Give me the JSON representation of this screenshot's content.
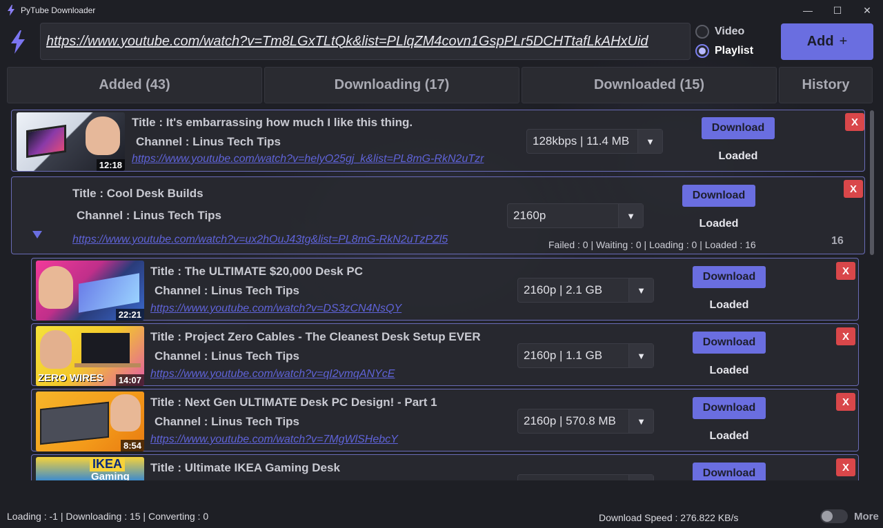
{
  "window": {
    "title": "PyTube Downloader",
    "icon": "bolt-icon",
    "minimize": "—",
    "maximize": "☐",
    "close": "✕"
  },
  "top": {
    "url_value": "https://www.youtube.com/watch?v=Tm8LGxTLtQk&list=PLlqZM4covn1GspPLr5DCHTtafLkAHxUid",
    "mode_video": "Video",
    "mode_playlist": "Playlist",
    "selected_mode": "Playlist",
    "add_label": "Add",
    "add_plus": "+"
  },
  "tabs": {
    "added": "Added (43)",
    "downloading": "Downloading (17)",
    "downloaded": "Downloaded (15)",
    "history": "History"
  },
  "items": [
    {
      "title": "Title : It's embarrassing how much I like this thing.",
      "channel": "Channel : Linus Tech Tips",
      "link": "https://www.youtube.com/watch?v=helyO25gj_k&list=PL8mG-RkN2uTzr",
      "duration": "12:18",
      "quality": "128kbps | 11.4 MB",
      "download_label": "Download",
      "status": "Loaded",
      "remove": "X"
    }
  ],
  "playlist": {
    "title": "Title : Cool Desk Builds",
    "channel": "Channel : Linus Tech Tips",
    "link": "https://www.youtube.com/watch?v=ux2hOuJ43tg&list=PL8mG-RkN2uTzPZl5",
    "quality": "2160p",
    "download_label": "Download",
    "status": "Loaded",
    "stats": "Failed : 0 |   Waiting : 0 |   Loading : 0 |   Loaded : 16",
    "count": "16",
    "remove": "X",
    "videos": [
      {
        "title": "Title : The ULTIMATE $20,000 Desk PC",
        "channel": "Channel : Linus Tech Tips",
        "link": "https://www.youtube.com/watch?v=DS3zCN4NsQY",
        "duration": "22:21",
        "quality": "2160p | 2.1 GB",
        "download_label": "Download",
        "status": "Loaded",
        "remove": "X"
      },
      {
        "title": "Title : Project Zero Cables - The Cleanest Desk Setup EVER",
        "channel": "Channel : Linus Tech Tips",
        "link": "https://www.youtube.com/watch?v=qI2vmqANYcE",
        "duration": "14:07",
        "thumb_text": "ZERO WIRES",
        "quality": "2160p | 1.1 GB",
        "download_label": "Download",
        "status": "Loaded",
        "remove": "X"
      },
      {
        "title": "Title : Next Gen ULTIMATE Desk PC Design! - Part 1",
        "channel": "Channel : Linus Tech Tips",
        "link": "https://www.youtube.com/watch?v=7MgWlSHebcY",
        "duration": "8:54",
        "quality": "2160p | 570.8 MB",
        "download_label": "Download",
        "status": "Loaded",
        "remove": "X"
      },
      {
        "title": "Title : Ultimate IKEA Gaming Desk",
        "thumb_text_1": "IKEA",
        "thumb_text_2": "Gaming",
        "download_label": "Download",
        "remove": "X"
      }
    ]
  },
  "footer": {
    "status": "Loading : -1 | Downloading : 15 |  Converting : 0",
    "speed": "Download Speed : 276.822 KB/s",
    "more": "More"
  },
  "colors": {
    "accent": "#6a6ee0",
    "danger": "#d9474a",
    "link": "#5f63d8",
    "background": "#1e1f25"
  }
}
